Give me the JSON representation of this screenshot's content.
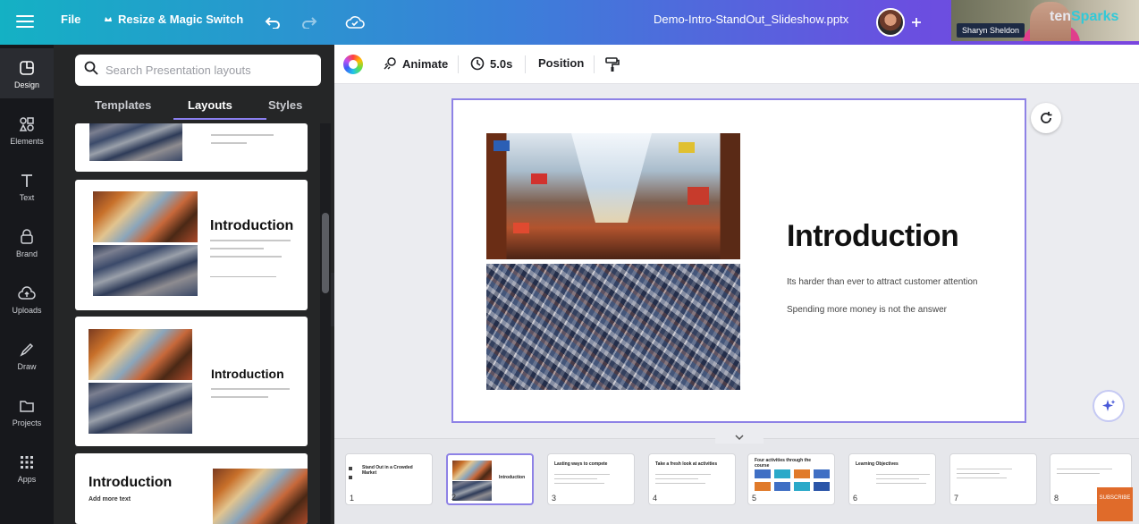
{
  "topbar": {
    "file_label": "File",
    "resize_label": "Resize & Magic Switch",
    "doc_title": "Demo-Intro-StandOut_Slideshow.pptx"
  },
  "webcam": {
    "person_name": "Sharyn Sheldon",
    "brand_prefix": "ten",
    "brand_suffix": "Sparks"
  },
  "leftnav": {
    "items": [
      {
        "label": "Design",
        "icon": "design-icon"
      },
      {
        "label": "Elements",
        "icon": "elements-icon"
      },
      {
        "label": "Text",
        "icon": "text-icon"
      },
      {
        "label": "Brand",
        "icon": "brand-icon"
      },
      {
        "label": "Uploads",
        "icon": "uploads-icon"
      },
      {
        "label": "Draw",
        "icon": "draw-icon"
      },
      {
        "label": "Projects",
        "icon": "projects-icon"
      },
      {
        "label": "Apps",
        "icon": "apps-icon"
      }
    ]
  },
  "panel": {
    "search_placeholder": "Search Presentation layouts",
    "tabs": [
      "Templates",
      "Layouts",
      "Styles"
    ],
    "active_tab": "Layouts",
    "cards": [
      {
        "title": "Introduction"
      },
      {
        "title": "Introduction"
      },
      {
        "title": "Introduction",
        "subtitle": "Add more text"
      }
    ]
  },
  "toolbar": {
    "animate_label": "Animate",
    "duration_label": "5.0s",
    "position_label": "Position"
  },
  "slide": {
    "title": "Introduction",
    "line1": "Its harder than ever to attract customer attention",
    "line2": "Spending more money is not the answer"
  },
  "filmstrip": {
    "pages": [
      {
        "num": "1",
        "title": "Stand Out in a Crowded Market"
      },
      {
        "num": "2",
        "title": "Introduction"
      },
      {
        "num": "3",
        "title": "Lasting ways to compete"
      },
      {
        "num": "4",
        "title": "Take a fresh look at activities"
      },
      {
        "num": "5",
        "title": "Four activities through the course"
      },
      {
        "num": "6",
        "title": "Learning Objectives"
      },
      {
        "num": "7",
        "title": ""
      },
      {
        "num": "8",
        "title": ""
      }
    ]
  },
  "subscribe_label": "SUBSCRIBE",
  "colors": {
    "accent": "#8e82e6",
    "panel_bg": "#252627",
    "nav_bg": "#17181c"
  }
}
